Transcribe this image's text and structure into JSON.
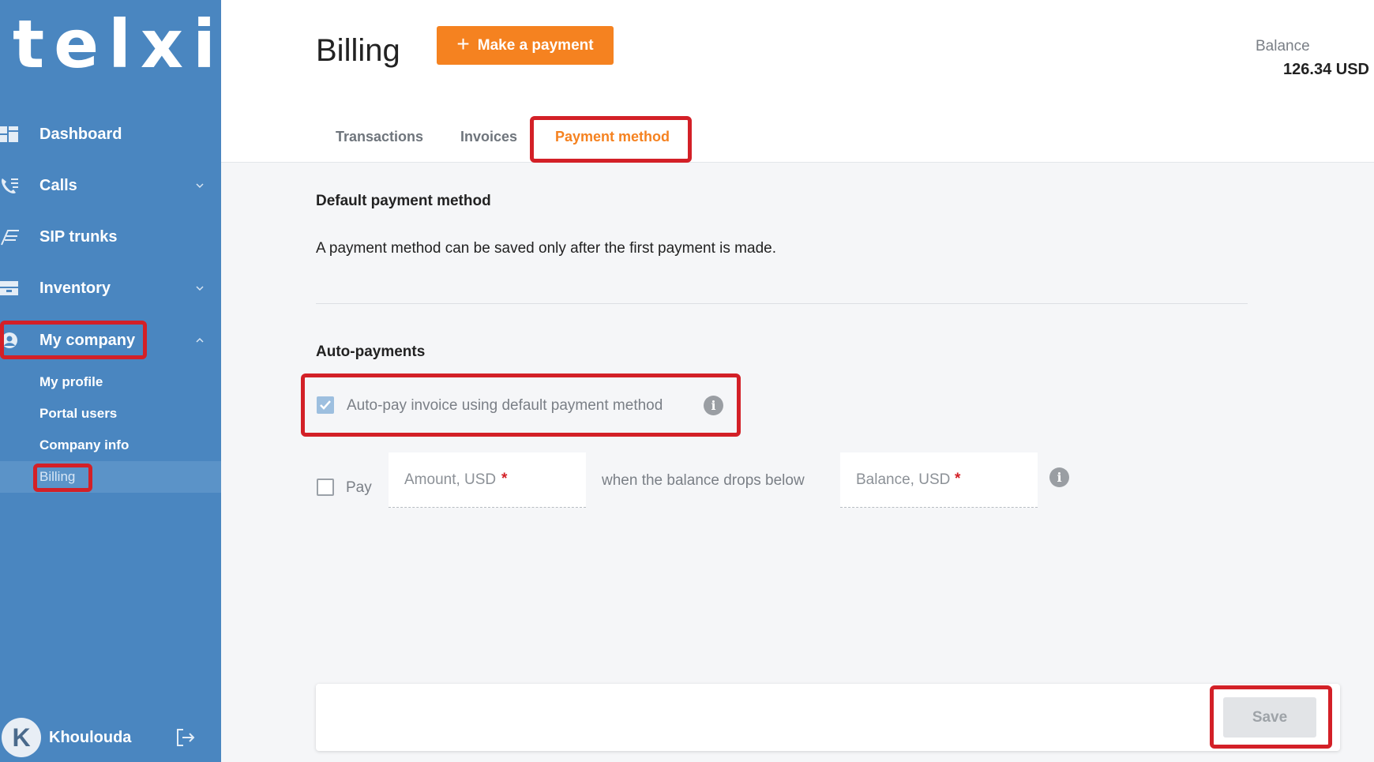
{
  "app": {
    "logo_text": "telxi"
  },
  "sidebar": {
    "items": [
      {
        "label": "Dashboard",
        "icon": "dashboard-icon"
      },
      {
        "label": "Calls",
        "icon": "phone-list-icon"
      },
      {
        "label": "SIP trunks",
        "icon": "sip-trunk-icon"
      },
      {
        "label": "Inventory",
        "icon": "inventory-icon"
      },
      {
        "label": "My company",
        "icon": "company-icon"
      }
    ],
    "sub_items": [
      {
        "label": "My profile"
      },
      {
        "label": "Portal users"
      },
      {
        "label": "Company info"
      },
      {
        "label": "Billing"
      }
    ],
    "user": {
      "initial": "K",
      "name": "Khoulouda"
    }
  },
  "header": {
    "title": "Billing",
    "make_payment_label": "Make a payment",
    "balance_label": "Balance",
    "balance_value": "126.34 USD",
    "tabs": [
      {
        "label": "Transactions"
      },
      {
        "label": "Invoices"
      },
      {
        "label": "Payment method",
        "active": true
      }
    ]
  },
  "main": {
    "default_method": {
      "title": "Default payment method",
      "note": "A payment method can be saved only after the first payment is made."
    },
    "auto_payments": {
      "title": "Auto-payments",
      "autopay_label": "Auto-pay invoice using default payment method",
      "autopay_checked": true,
      "pay_label": "Pay",
      "pay_checked": false,
      "amount_placeholder": "Amount, USD",
      "between_text": "when the balance drops below",
      "balance_placeholder": "Balance, USD",
      "required_mark": "*"
    },
    "save_label": "Save"
  },
  "colors": {
    "sidebar": "#4a86c0",
    "accent": "#f58220",
    "highlight": "#d32027"
  }
}
